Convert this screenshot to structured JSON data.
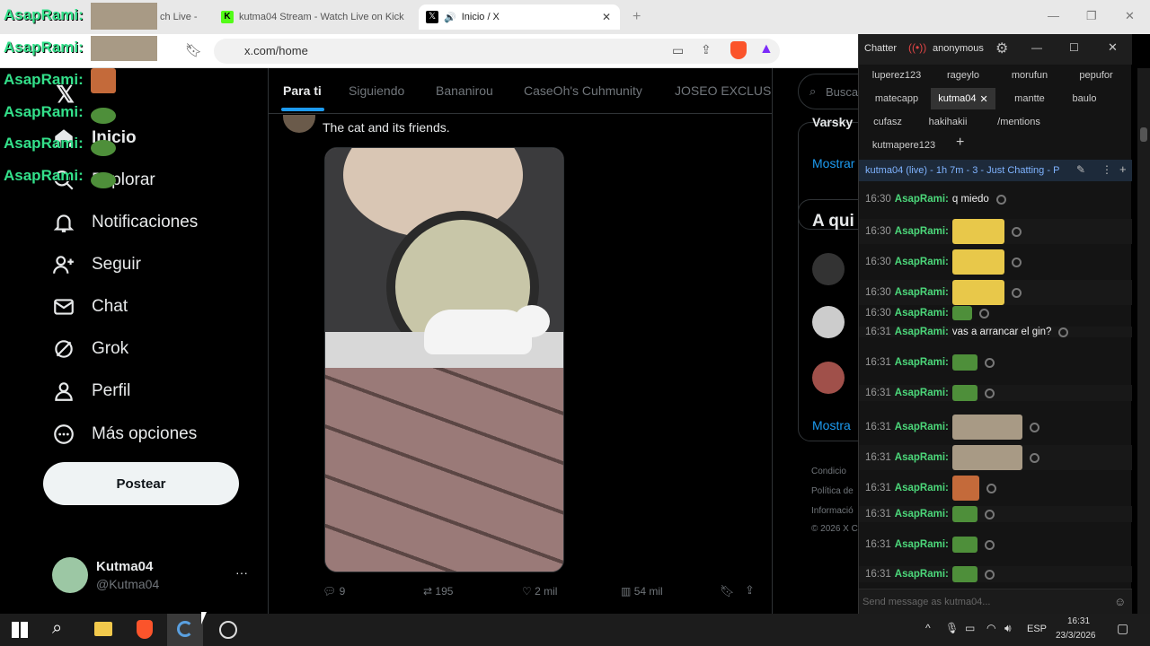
{
  "browser": {
    "tabs": [
      {
        "label": "ch Live -"
      },
      {
        "label": "kutma04 Stream - Watch Live on Kick"
      },
      {
        "label": "Inicio / X"
      }
    ],
    "url": "x.com/home",
    "tab_add": "+"
  },
  "overlay": {
    "lines": [
      "AsapRami:",
      "AsapRami:",
      "AsapRami:",
      "AsapRami:",
      "AsapRami:",
      "AsapRami:"
    ]
  },
  "x": {
    "nav": [
      {
        "label": "Inicio"
      },
      {
        "label": "Explorar"
      },
      {
        "label": "Notificaciones"
      },
      {
        "label": "Seguir"
      },
      {
        "label": "Chat"
      },
      {
        "label": "Grok"
      },
      {
        "label": "Perfil"
      },
      {
        "label": "Más opciones"
      }
    ],
    "post_button": "Postear",
    "account": {
      "name": "Kutma04",
      "handle": "@Kutma04",
      "more": "···"
    },
    "feed_tabs": [
      "Para ti",
      "Siguiendo",
      "Bananirou",
      "CaseOh's Cuhmunity",
      "JOSEO EXCLUSIV"
    ],
    "tweet": {
      "text": "The cat and its friends.",
      "stats": {
        "replies": "9",
        "retweets": "195",
        "likes": "2 mil",
        "views": "54 mil"
      }
    },
    "right": {
      "search": "Busca",
      "trend_label": "Varsky",
      "show_more": "Mostrar",
      "who_to_follow": "A qui",
      "show_more2": "Mostra",
      "footer": [
        "Condicio",
        "Política de",
        "Informació",
        "© 2026 X C"
      ]
    }
  },
  "chatterino": {
    "title": "Chatter",
    "user": "anonymous",
    "tabs_row1": [
      "luperez123",
      "rageylo",
      "morufun",
      "pepufor"
    ],
    "tabs_row2": [
      "matecapp",
      "kutma04",
      "mantte",
      "baulo"
    ],
    "tabs_row3": [
      "cufasz",
      "hakihakii",
      "/mentions"
    ],
    "tabs_row4": [
      "kutmapere123"
    ],
    "tab_close": "✕",
    "tab_add": "+",
    "split_header": "kutma04 (live) - 1h 7m - 3 - Just Chatting - P",
    "messages": [
      {
        "time": "16:30",
        "user": "AsapRami:",
        "text": "q miedo",
        "emote": ""
      },
      {
        "time": "16:30",
        "user": "AsapRami:",
        "text": "",
        "emote": "cheems"
      },
      {
        "time": "16:30",
        "user": "AsapRami:",
        "text": "",
        "emote": "cheems"
      },
      {
        "time": "16:30",
        "user": "AsapRami:",
        "text": "",
        "emote": "cheems"
      },
      {
        "time": "16:30",
        "user": "AsapRami:",
        "text": "",
        "emote": "pepe-small"
      },
      {
        "time": "16:31",
        "user": "AsapRami:",
        "text": "vas a arrancar el gin?",
        "emote": ""
      },
      {
        "time": "16:31",
        "user": "AsapRami:",
        "text": "",
        "emote": "pepe"
      },
      {
        "time": "16:31",
        "user": "AsapRami:",
        "text": "",
        "emote": "pepe"
      },
      {
        "time": "16:31",
        "user": "AsapRami:",
        "text": "",
        "emote": "cats"
      },
      {
        "time": "16:31",
        "user": "AsapRami:",
        "text": "",
        "emote": "cats"
      },
      {
        "time": "16:31",
        "user": "AsapRami:",
        "text": "",
        "emote": "face"
      },
      {
        "time": "16:31",
        "user": "AsapRami:",
        "text": "",
        "emote": "pepe"
      },
      {
        "time": "16:31",
        "user": "AsapRami:",
        "text": "",
        "emote": "pepe"
      },
      {
        "time": "16:31",
        "user": "AsapRami:",
        "text": "",
        "emote": "pepe"
      }
    ],
    "input_placeholder": "Send message as kutma04..."
  },
  "taskbar": {
    "lang": "ESP",
    "time": "16:31",
    "date": "23/3/2026"
  },
  "colors": {
    "accent": "#1d9bf0",
    "chat_name": "#4cd77a",
    "overlay_name": "#33e08a"
  }
}
